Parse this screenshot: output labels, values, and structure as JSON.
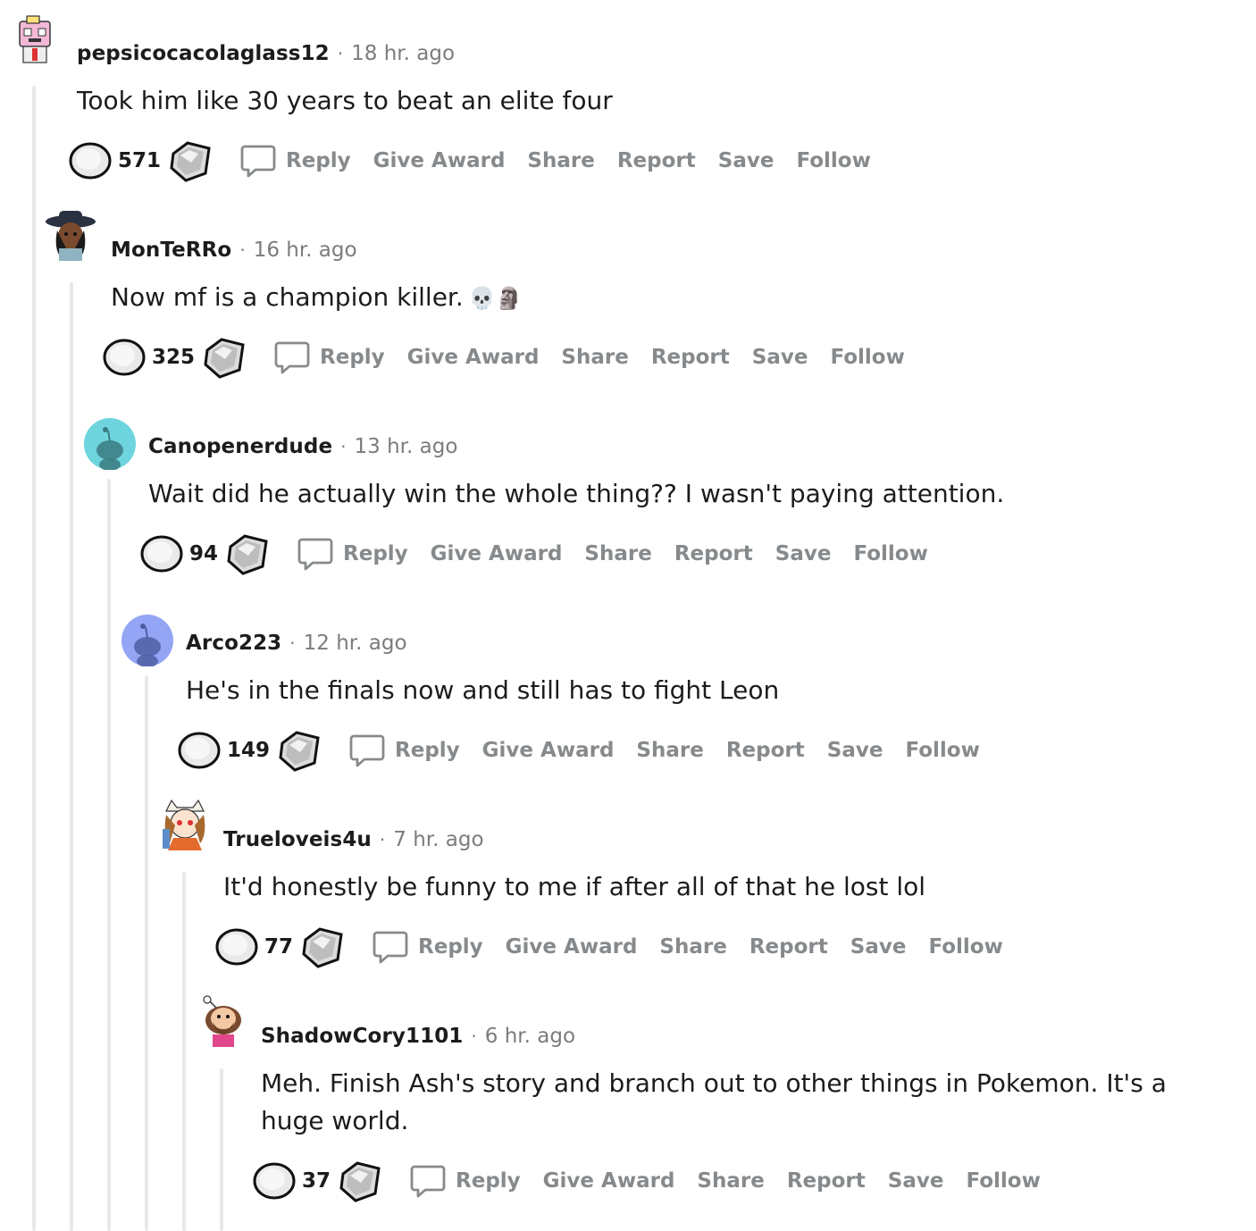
{
  "actions": {
    "reply": "Reply",
    "give_award": "Give Award",
    "share": "Share",
    "report": "Report",
    "save": "Save",
    "follow": "Follow"
  },
  "separator": "·",
  "comments": [
    {
      "username": "pepsicocacolaglass12",
      "time": "18 hr. ago",
      "body": "Took him like 30 years to beat an elite four",
      "score": "571",
      "avatar": "pink-robot-avatar"
    },
    {
      "username": "MonTeRRo",
      "time": "16 hr. ago",
      "body": "Now mf is a champion killer.",
      "emoji": "💀🗿",
      "score": "325",
      "avatar": "hat-wearer-avatar"
    },
    {
      "username": "Canopenerdude",
      "time": "13 hr. ago",
      "body": "Wait did he actually win the whole thing?? I wasn't paying attention.",
      "score": "94",
      "avatar": "default-teal-snoo-avatar"
    },
    {
      "username": "Arco223",
      "time": "12 hr. ago",
      "body": "He's in the finals now and still has to fight Leon",
      "score": "149",
      "avatar": "default-blue-snoo-avatar"
    },
    {
      "username": "Trueloveis4u",
      "time": "7 hr. ago",
      "body": "It'd honestly be funny to me if after all of that he lost lol",
      "score": "77",
      "avatar": "cat-hat-avatar"
    },
    {
      "username": "ShadowCory1101",
      "time": "6 hr. ago",
      "body": "Meh. Finish Ash's story and branch out to other things in Pokemon. It's a huge world.",
      "score": "37",
      "avatar": "bearded-snoo-avatar"
    }
  ],
  "colors": {
    "text": "#1c1c1c",
    "meta": "#7c7c7c",
    "action": "#878a8c",
    "thread_line": "#e8e8e8",
    "teal_avatar": "#6ed5de",
    "blue_avatar": "#94a5f5"
  }
}
